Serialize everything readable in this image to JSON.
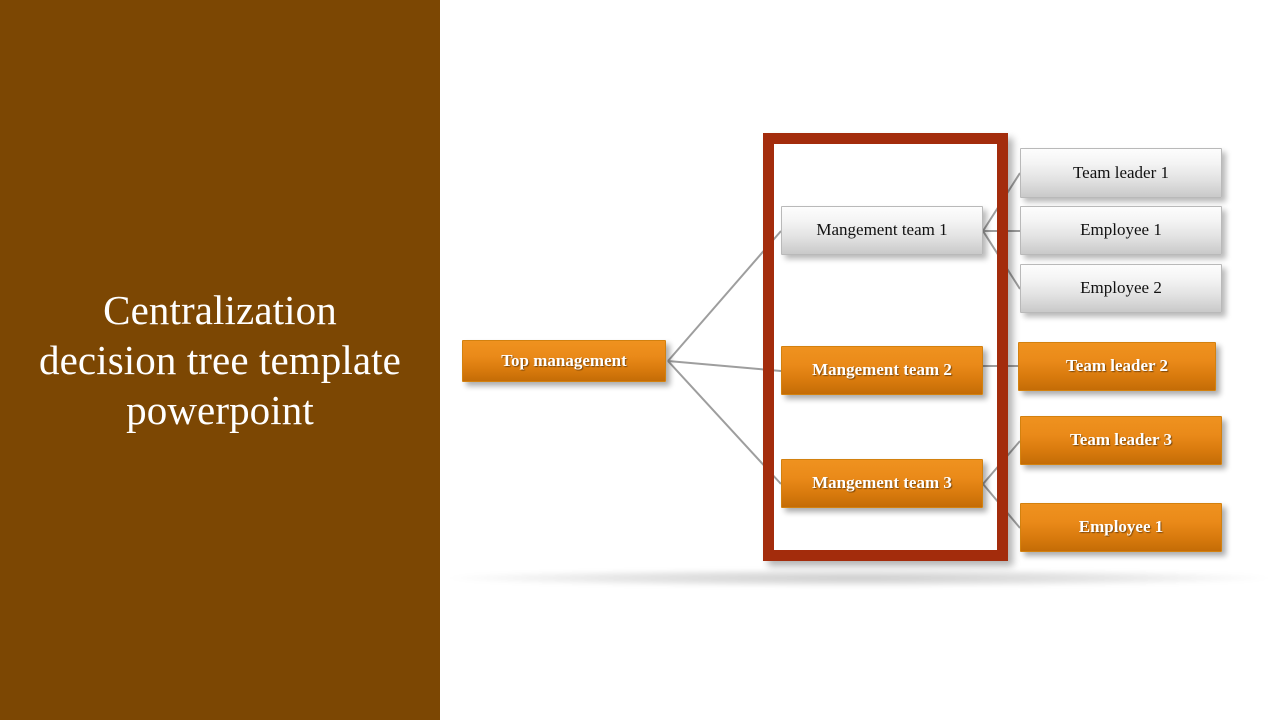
{
  "slide": {
    "background_color": "#ffffff",
    "panel_color": "#7c4703",
    "accent_orange": "#ea8a19",
    "frame_color": "#a32c0c",
    "connector_color": "#9e9e9e"
  },
  "title": {
    "text": "Centralization\ndecision tree template\npowerpoint"
  },
  "diagram": {
    "type": "org-chart",
    "root": {
      "id": "top-management",
      "label": "Top management",
      "style": "orange"
    },
    "level2": [
      {
        "id": "team-1",
        "label": "Mangement team 1",
        "style": "silver"
      },
      {
        "id": "team-2",
        "label": "Mangement team 2",
        "style": "orange"
      },
      {
        "id": "team-3",
        "label": "Mangement team 3",
        "style": "orange"
      }
    ],
    "level3": [
      {
        "id": "leader-1",
        "label": "Team leader 1",
        "style": "silver",
        "parent": "team-1"
      },
      {
        "id": "employee-1",
        "label": "Employee 1",
        "style": "silver",
        "parent": "team-1"
      },
      {
        "id": "employee-2",
        "label": "Employee 2",
        "style": "silver",
        "parent": "team-1"
      },
      {
        "id": "leader-2",
        "label": "Team leader 2",
        "style": "orange",
        "parent": "team-2"
      },
      {
        "id": "leader-3",
        "label": "Team leader 3",
        "style": "orange",
        "parent": "team-3"
      },
      {
        "id": "employee-3",
        "label": "Employee 1",
        "style": "orange",
        "parent": "team-3"
      }
    ],
    "highlight_frame": {
      "label": "management-team-column-highlight",
      "color": "#a32c0c"
    }
  }
}
